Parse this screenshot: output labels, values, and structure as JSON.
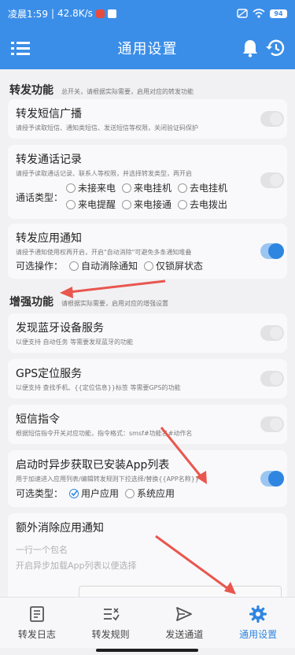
{
  "status_bar": {
    "time": "凌晨1:59",
    "speed": "42.8K/s",
    "battery": "94"
  },
  "app_bar": {
    "title": "通用设置"
  },
  "sections": {
    "forward": {
      "title": "转发功能",
      "desc": "总开关，请根据实际需要，启用对应的转发功能"
    },
    "enhance": {
      "title": "增强功能",
      "desc": "请根据实际需要，启用对应的增强设置"
    }
  },
  "cards": {
    "sms": {
      "title": "转发短信广播",
      "desc": "请授予读取短信、通知类短信、发送短信等权限，关闭验证码保护",
      "enabled": false
    },
    "calls": {
      "title": "转发通话记录",
      "desc": "请授予读取通话记录、联系人等权限，并选择转发类型，再开启",
      "type_label": "通话类型：",
      "options_row1": [
        "未接来电",
        "来电挂机",
        "去电挂机"
      ],
      "options_row2": [
        "来电提醒",
        "来电接通",
        "去电拨出"
      ],
      "enabled": false
    },
    "app_notify": {
      "title": "转发应用通知",
      "desc": "请授予通知使用权再开启，开启\"自动消除\"可避免多条通知堆叠",
      "op_label": "可选操作：",
      "options": [
        "自动消除通知",
        "仅锁屏状态"
      ],
      "enabled": true
    },
    "bluetooth": {
      "title": "发现蓝牙设备服务",
      "desc": "以便支持 自动任务 等需要发现蓝牙的功能",
      "enabled": false
    },
    "gps": {
      "title": "GPS定位服务",
      "desc": "以便支持 查找手机、{{定位信息}}标签 等需要GPS的功能",
      "enabled": false
    },
    "sms_cmd": {
      "title": "短信指令",
      "desc": "根据短信指令开关对应功能，指令格式：smsf#功能名#动作名",
      "enabled": false
    },
    "async_apps": {
      "title": "启动时异步获取已安装App列表",
      "desc": "用于加速进入应用列表/编辑转发规则下拉选择/替换{{APP名称}}",
      "type_label": "可选类型：",
      "options": [
        "用户应用",
        "系统应用"
      ],
      "checked": [
        true,
        false
      ],
      "enabled": true
    },
    "extra_clear": {
      "title": "额外消除应用通知",
      "placeholder_1": "一行一个包名",
      "placeholder_2": "开启异步加载App列表以便选择"
    }
  },
  "bottom_nav": {
    "items": [
      "转发日志",
      "转发规则",
      "发送通道",
      "通用设置"
    ],
    "active": "通用设置"
  },
  "colors": {
    "accent": "#2f86e0",
    "app_bar": "#3b8ee8",
    "annotation": "#e9564e"
  }
}
